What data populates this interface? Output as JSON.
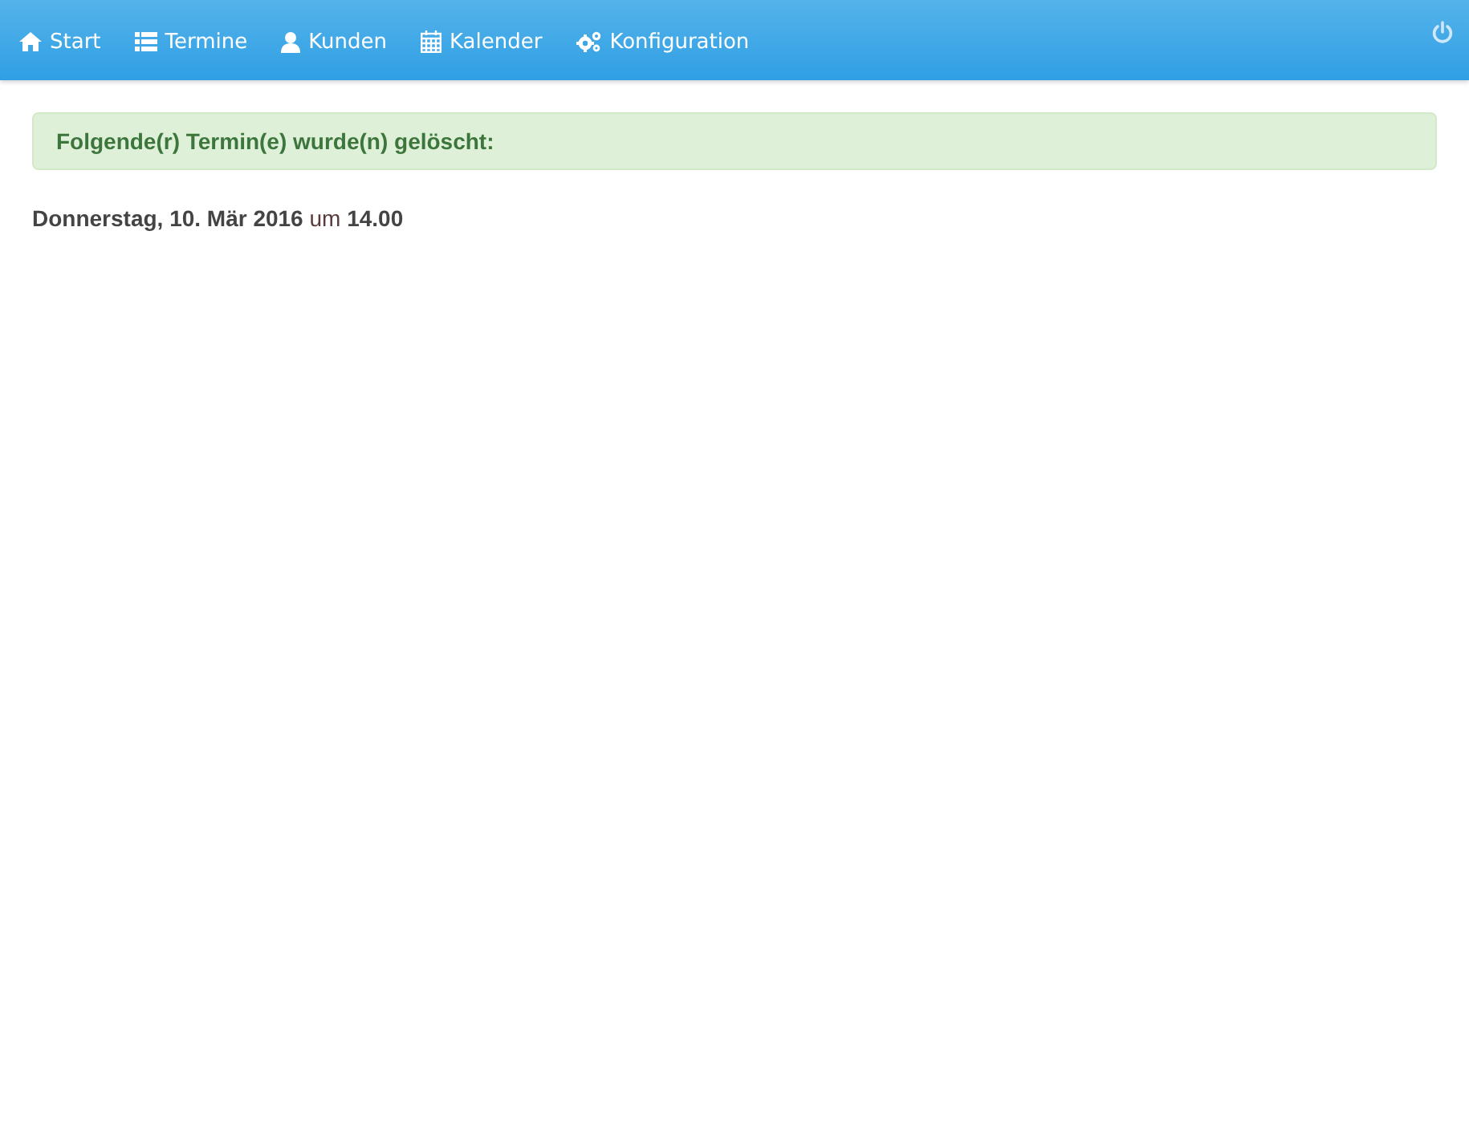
{
  "navbar": {
    "items": [
      {
        "kind": "home",
        "label": "Start"
      },
      {
        "kind": "list",
        "label": "Termine"
      },
      {
        "kind": "user",
        "label": "Kunden"
      },
      {
        "kind": "calendar",
        "label": "Kalender"
      },
      {
        "kind": "gears",
        "label": "Konfiguration"
      }
    ]
  },
  "alert": {
    "text": "Folgende(r) Termin(e) wurde(n) gelöscht:"
  },
  "deleted_appointment": "**Donnerstag, 10. Mär 2016** um **14.00**"
}
